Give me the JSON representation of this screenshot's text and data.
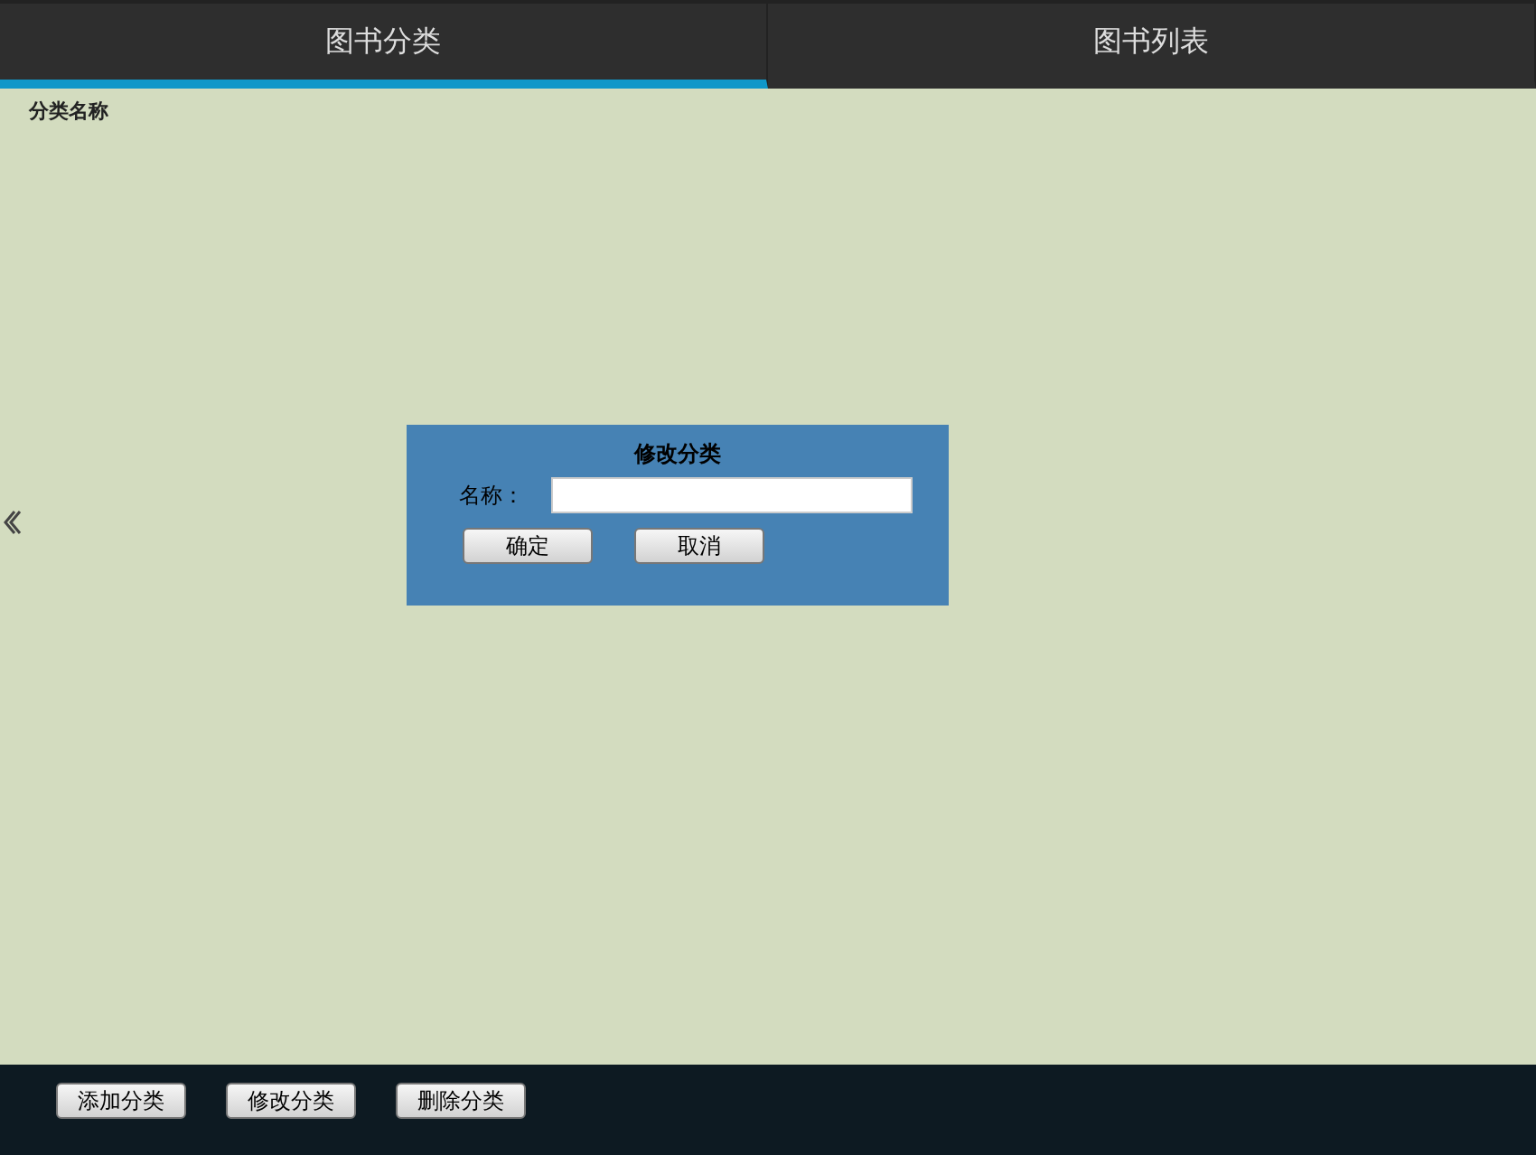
{
  "tabs": [
    {
      "label": "图书分类",
      "selected": true
    },
    {
      "label": "图书列表",
      "selected": false
    }
  ],
  "list_header": "分类名称",
  "dialog": {
    "title": "修改分类",
    "field_label": "名称：",
    "buttons": [
      "确定",
      "取消"
    ]
  },
  "footer_buttons": [
    "添加分类",
    "修改分类",
    "删除分类"
  ]
}
